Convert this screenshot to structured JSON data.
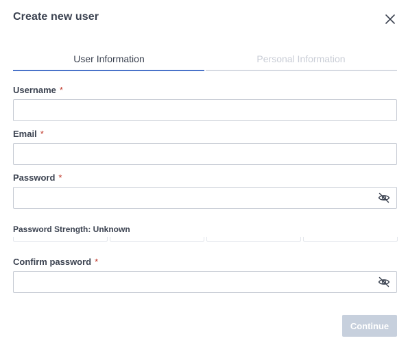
{
  "dialog": {
    "title": "Create new user",
    "close_icon": "close-icon"
  },
  "tabs": [
    {
      "label": "User Information",
      "state": "active"
    },
    {
      "label": "Personal Information",
      "state": "inactive"
    }
  ],
  "form": {
    "username": {
      "label": "Username",
      "required_marker": "*",
      "value": "",
      "placeholder": ""
    },
    "email": {
      "label": "Email",
      "required_marker": "*",
      "value": "",
      "placeholder": ""
    },
    "password": {
      "label": "Password",
      "required_marker": "*",
      "value": "",
      "placeholder": "",
      "toggle_icon": "eye-slash-icon"
    },
    "password_strength": {
      "label": "Password Strength: Unknown",
      "segments": 4,
      "filled": 0
    },
    "confirm_password": {
      "label": "Confirm password",
      "required_marker": "*",
      "value": "",
      "placeholder": "",
      "toggle_icon": "eye-slash-icon"
    }
  },
  "actions": {
    "continue_label": "Continue",
    "continue_enabled": false
  },
  "colors": {
    "accent": "#4a73c9",
    "required": "#c0392b",
    "button_disabled": "#c7d0dd",
    "inactive_tab_text": "#c9cdd6"
  }
}
